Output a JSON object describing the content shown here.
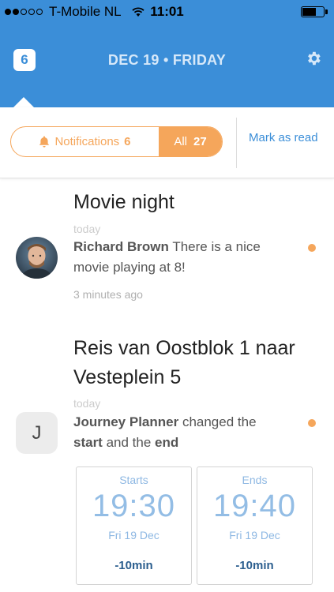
{
  "status": {
    "carrier": "T-Mobile NL",
    "time": "11:01",
    "signal_icon": "signal-dots-icon",
    "wifi_icon": "wifi-icon",
    "battery_level": 0.6
  },
  "header": {
    "badge_count": "6",
    "date": "DEC 19 • FRIDAY",
    "settings_icon": "gear-icon"
  },
  "filter": {
    "notifications_label": "Notifications",
    "notifications_count": "6",
    "all_label": "All",
    "all_count": "27",
    "mark_read": "Mark as read",
    "accent": "#f5a65b"
  },
  "items": [
    {
      "title": "Movie night",
      "when": "today",
      "sender": "Richard Brown",
      "message": " There is a nice movie playing at 8!",
      "ago": "3 minutes ago",
      "unread": true
    },
    {
      "title_line1": "Reis van Oostblok 1 naar",
      "title_line2": "Vesteplein 5",
      "when": "today",
      "avatar_letter": "J",
      "sender": "Journey Planner",
      "text1": " changed the",
      "bold1": "start",
      "text2": " and the ",
      "bold2": "end",
      "unread": true,
      "starts": {
        "label": "Starts",
        "time": "19:30",
        "date": "Fri 19 Dec",
        "delta": "-10min"
      },
      "ends": {
        "label": "Ends",
        "time": "19:40",
        "date": "Fri 19 Dec",
        "delta": "-10min"
      }
    }
  ],
  "colors": {
    "header_blue": "#3b8ed8",
    "unread_dot": "#f5a65b"
  }
}
